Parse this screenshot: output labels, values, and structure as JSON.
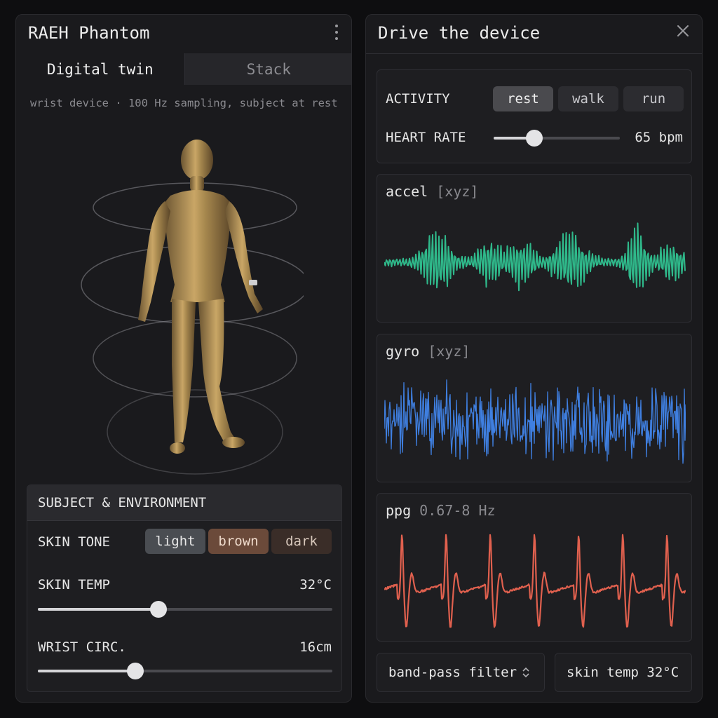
{
  "left_panel": {
    "title": "RAEH Phantom",
    "tabs": [
      {
        "label": "Digital twin",
        "active": true
      },
      {
        "label": "Stack",
        "active": false
      }
    ],
    "subtitle": "wrist device · 100 Hz sampling, subject at rest",
    "subject": {
      "header": "SUBJECT & ENVIRONMENT",
      "skin_tone": {
        "label": "SKIN TONE",
        "options": [
          "light",
          "brown",
          "dark"
        ],
        "selected": "light",
        "colors": {
          "light": "#4a4d52",
          "brown": "#6b4a3a",
          "dark": "#3a2d28"
        }
      },
      "skin_temp": {
        "label": "SKIN TEMP",
        "value": "32°C",
        "fraction": 0.41
      },
      "wrist_circ": {
        "label": "WRIST CIRC.",
        "value": "16cm",
        "fraction": 0.33
      }
    }
  },
  "right_panel": {
    "title": "Drive the device",
    "activity": {
      "label": "ACTIVITY",
      "options": [
        "rest",
        "walk",
        "run"
      ],
      "selected": "rest"
    },
    "heart_rate": {
      "label": "HEART RATE",
      "value": "65 bpm",
      "fraction": 0.32
    },
    "cards": {
      "accel": {
        "name": "accel",
        "axes": "[xyz]",
        "color": "#2fb88a"
      },
      "gyro": {
        "name": "gyro",
        "axes": "[xyz]",
        "color": "#3f7fe0"
      },
      "ppg": {
        "name": "ppg",
        "band": "0.67-8 Hz",
        "color": "#e0604e"
      }
    },
    "filter_button": {
      "label": "band-pass filter",
      "icon": "up-down-chevron-icon"
    },
    "temp_button": {
      "label": "skin temp 32°C"
    }
  },
  "colors": {
    "accent_light": "#d5d5d8",
    "panel": "#1a1a1d",
    "bg": "#0e0e10"
  }
}
